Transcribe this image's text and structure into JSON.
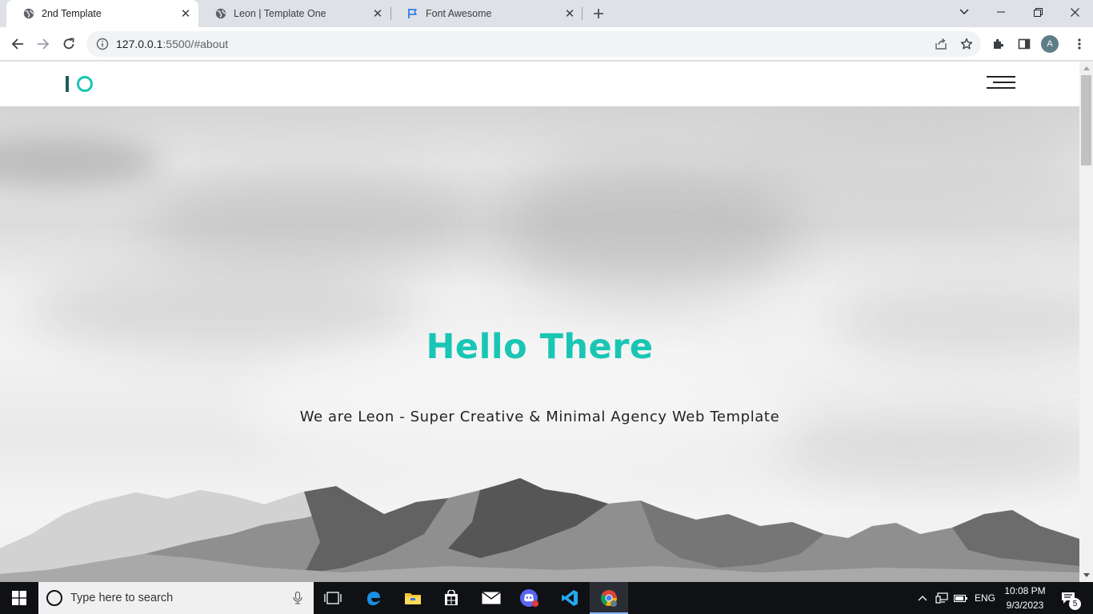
{
  "browser": {
    "tabs": [
      {
        "title": "2nd Template",
        "active": true,
        "icon": "globe-icon"
      },
      {
        "title": "Leon | Template One",
        "active": false,
        "icon": "globe-icon"
      },
      {
        "title": "Font Awesome",
        "active": false,
        "icon": "flag-icon"
      }
    ],
    "url_host": "127.0.0.1",
    "url_rest": ":5500/#about",
    "profile_initial": "A"
  },
  "page": {
    "hero_title": "Hello There",
    "hero_subtitle": "We are Leon - Super Creative & Minimal Agency Web Template",
    "accent_color": "#19c6b4"
  },
  "taskbar": {
    "search_placeholder": "Type here to search",
    "language": "ENG",
    "time": "10:08 PM",
    "date": "9/3/2023",
    "notification_count": "5"
  }
}
